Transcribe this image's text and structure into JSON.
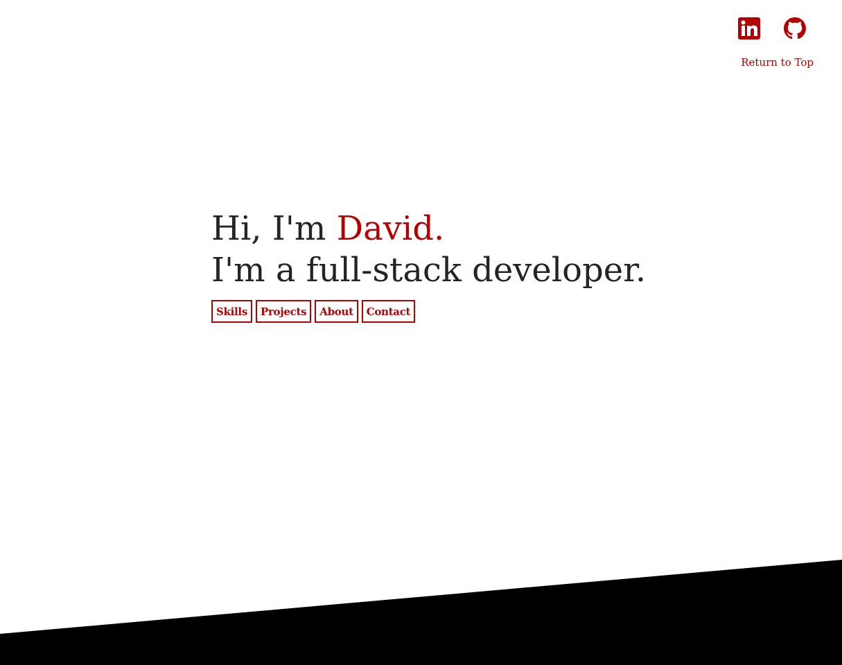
{
  "header": {
    "social": [
      {
        "name": "linkedin-icon",
        "color": "#b30000"
      },
      {
        "name": "github-icon",
        "color": "#b30000"
      }
    ],
    "return_to_top": "Return to Top"
  },
  "hero": {
    "greeting_prefix": "Hi, I'm ",
    "name": "David.",
    "tagline": "I'm a full-stack developer."
  },
  "nav": {
    "skills": "Skills",
    "projects": "Projects",
    "about": "About",
    "contact": "Contact"
  },
  "colors": {
    "accent": "#b30000",
    "text": "#212529",
    "band": "#000000",
    "background": "#ffffff"
  }
}
